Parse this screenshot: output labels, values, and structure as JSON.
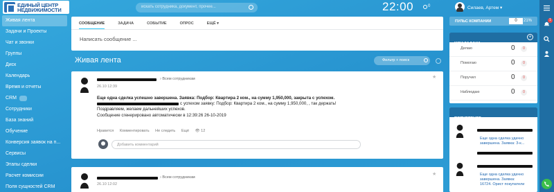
{
  "topbar": {
    "logo_line1": "ЕДИНЫЙ ЦЕНТР",
    "logo_line2": "НЕДВИЖИМОСТИ",
    "search_placeholder": "искать сотрудника, документ, прочее...",
    "clock": "22:00",
    "clock_count": "0",
    "user_name": "Силаев, Артем"
  },
  "sidebar": {
    "items": [
      {
        "label": "Живая лента",
        "active": true
      },
      {
        "label": "Задачи и Проекты"
      },
      {
        "label": "Чат и звонки"
      },
      {
        "label": "Группы"
      },
      {
        "label": "Диск"
      },
      {
        "label": "Календарь"
      },
      {
        "label": "Время и отчеты"
      },
      {
        "label": "CRM"
      },
      {
        "label": "Сотрудники"
      },
      {
        "label": "База знаний"
      },
      {
        "label": "Обучение"
      },
      {
        "label": "Конверсия заявок на п..."
      },
      {
        "label": "Сервисы"
      },
      {
        "label": "Этапы сделки"
      },
      {
        "label": "Расчет комиссии"
      },
      {
        "label": "Поля сущностей CRM"
      }
    ]
  },
  "composer": {
    "tabs": [
      "Сообщение",
      "Задача",
      "Событие",
      "Опрос",
      "Ещё"
    ],
    "placeholder": "Написать сообщение ..."
  },
  "feed": {
    "title": "Живая лента",
    "filter_placeholder": "Фильтр + поиск"
  },
  "posts": [
    {
      "to": "Всем сотрудникам",
      "time": "26.10 12:39",
      "title": "Еще одна сделка успешно завершена. Заявка: Подбор: Квартира 2 ком., на сумму 1,950,000, закрыта с успехом.",
      "line2": "с успехом заявку: Подбор: Квартира 2 ком., на сумму 1,950,000, , так держать!",
      "line3": "Поздравляем, желаем дальнейших успехов.",
      "line4": "Сообщение сгенерировано автоматически в 12:39:26 26-10-2019",
      "actions": [
        "Нравится",
        "Комментировать",
        "Не следить",
        "Ещё"
      ],
      "views": "12",
      "comment_placeholder": "Добавить комментарий"
    },
    {
      "to": "Всем сотрудникам",
      "time": "26.10 12:02"
    }
  ],
  "right_panel": {
    "company_pulse_label": "Пульс компании",
    "company_pulse_value": "0",
    "company_pulse_percent": "21%",
    "tasks_header": "Мои задачи",
    "tasks": [
      {
        "label": "Делаю",
        "count": "0",
        "badge": "0"
      },
      {
        "label": "Помогаю",
        "count": "0",
        "badge": "0"
      },
      {
        "label": "Поручил",
        "count": "0",
        "badge": "0"
      },
      {
        "label": "Наблюдаю",
        "count": "0",
        "badge": "0"
      }
    ],
    "popular_header": "Популярное",
    "popular_lines": [
      "Еще одна сделка удачно",
      "завершена. Заявка: З-к...",
      "Еще одна сделка удачно",
      "завершена. Заявка:",
      "16724. Орист покупатели"
    ]
  },
  "right_bar": {
    "notification_count": "1"
  },
  "colors": {
    "background": "#2fa0d8",
    "accent": "#2fc6f6",
    "alert": "#e94b4b",
    "call": "#3bbf4a"
  }
}
